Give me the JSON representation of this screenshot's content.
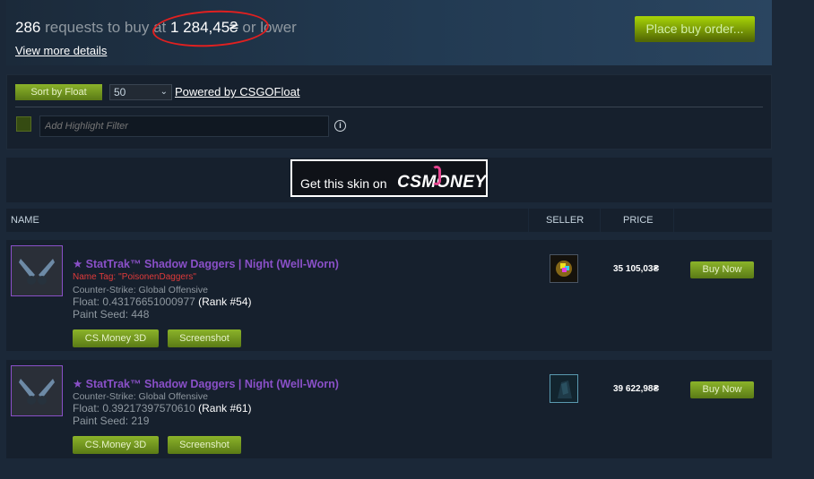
{
  "buy_orders": {
    "count": "286",
    "mid_text": "requests to buy at",
    "price": "1 284,45₴",
    "suffix": "or lower",
    "view_details": "View more details",
    "place_order": "Place buy order..."
  },
  "float_controls": {
    "sort_label": "Sort by Float",
    "page_size": "50",
    "powered_by": "Powered by CSGOFloat",
    "highlight_placeholder": "Add Highlight Filter",
    "info_glyph": "i"
  },
  "banner": {
    "text": "Get this skin on",
    "logo": "CS.MONEY",
    "logo_left": "CS",
    "logo_right": "MONEY"
  },
  "list_header": {
    "name": "NAME",
    "seller": "SELLER",
    "price": "PRICE"
  },
  "listings": [
    {
      "name": "★ StatTrak™ Shadow Daggers | Night (Well-Worn)",
      "name_tag": "Name Tag: ''PoisonenDaggers''",
      "game": "Counter-Strike: Global Offensive",
      "float_label": "Float: 0.43176651000977",
      "rank": "(Rank #54)",
      "seed": "Paint Seed: 448",
      "btn_3d": "CS.Money 3D",
      "btn_screenshot": "Screenshot",
      "price": "35 105,03₴",
      "buy": "Buy Now"
    },
    {
      "name": "★ StatTrak™ Shadow Daggers | Night (Well-Worn)",
      "game": "Counter-Strike: Global Offensive",
      "float_label": "Float: 0.39217397570610",
      "rank": "(Rank #61)",
      "seed": "Paint Seed: 219",
      "btn_3d": "CS.Money 3D",
      "btn_screenshot": "Screenshot",
      "price": "39 622,98₴",
      "buy": "Buy Now"
    }
  ],
  "colors": {
    "background": "#1b2838",
    "panel": "#16202d",
    "accent_green": "#8bb32a",
    "item_name_purple": "#8a50c8",
    "name_tag_red": "#e03a3a",
    "annotation_circle": "#e02020"
  }
}
